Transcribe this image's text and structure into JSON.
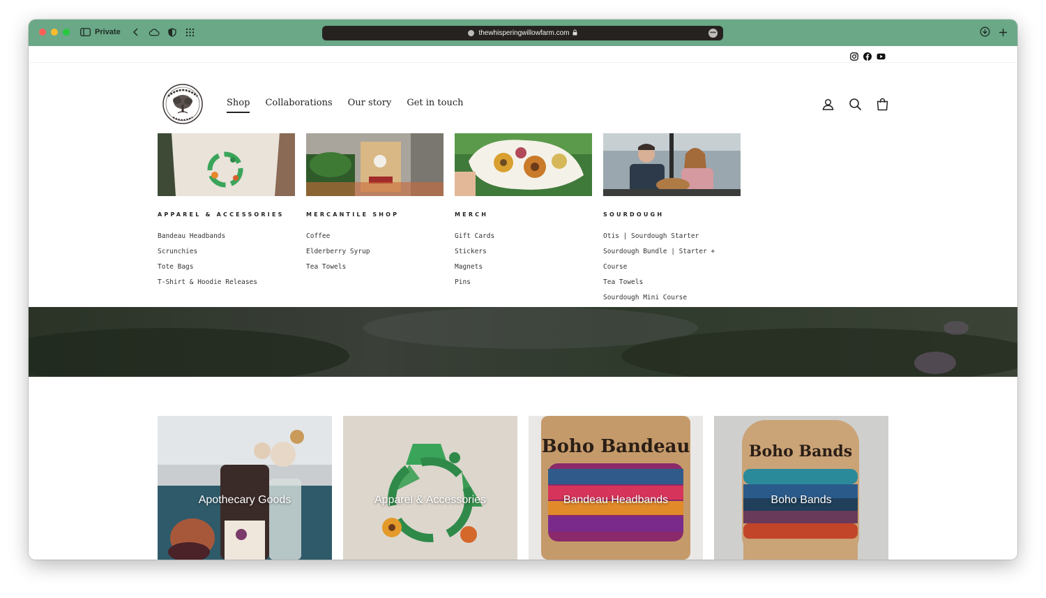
{
  "browser": {
    "private_label": "Private",
    "url": "thewhisperingwillowfarm.com"
  },
  "colors": {
    "chrome_bg": "#6aa887",
    "url_bar_bg": "#26221f",
    "text": "#222222"
  },
  "social_icons": [
    "instagram-icon",
    "facebook-icon",
    "youtube-icon"
  ],
  "brand": {
    "logo_line1": "Whispering Willow",
    "logo_line2": "Farm"
  },
  "nav": {
    "items": [
      {
        "label": "Shop",
        "active": true
      },
      {
        "label": "Collaborations",
        "active": false
      },
      {
        "label": "Our story",
        "active": false
      },
      {
        "label": "Get in touch",
        "active": false
      }
    ]
  },
  "header_icons": [
    "account-icon",
    "search-icon",
    "cart-icon"
  ],
  "mega_menu": {
    "columns": [
      {
        "heading": "APPAREL & ACCESSORIES",
        "links": [
          "Bandeau Headbands",
          "Scrunchies",
          "Tote Bags",
          "T-Shirt & Hoodie Releases"
        ]
      },
      {
        "heading": "MERCANTILE SHOP",
        "links": [
          "Coffee",
          "Elderberry Syrup",
          "Tea Towels"
        ]
      },
      {
        "heading": "MERCH",
        "links": [
          "Gift Cards",
          "Stickers",
          "Magnets",
          "Pins"
        ]
      },
      {
        "heading": "SOURDOUGH",
        "links": [
          "Otis | Sourdough Starter",
          "Sourdough Bundle | Starter + Course",
          "Tea Towels",
          "Sourdough Mini Course"
        ]
      }
    ]
  },
  "collections": {
    "tiles": [
      {
        "label": "Apothecary Goods"
      },
      {
        "label": "Apparel & Accessories"
      },
      {
        "label": "Bandeau Headbands"
      },
      {
        "label": "Boho Bands"
      }
    ]
  }
}
